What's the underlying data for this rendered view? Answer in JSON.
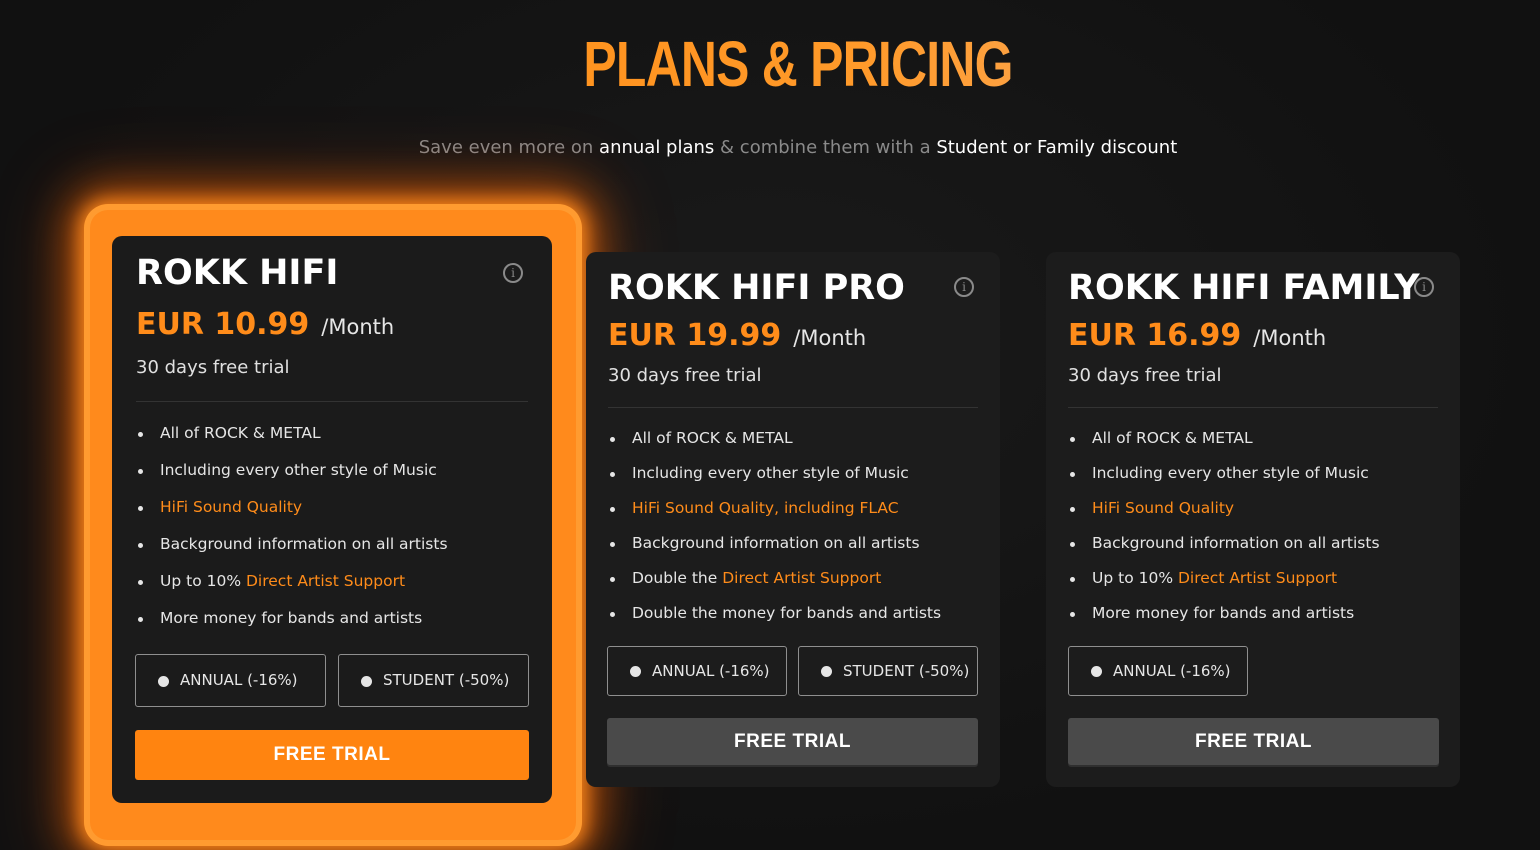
{
  "header": {
    "title": "PLANS & PRICING",
    "subtitle_parts": [
      "Save even more on ",
      "annual plans",
      " & combine them with a ",
      "Student or Family discount"
    ]
  },
  "colors": {
    "accent": "#ff8c1a",
    "background": "#111111",
    "card": "#1c1c1c",
    "cta_primary": "#ff8410",
    "cta_secondary": "#4a4a4a"
  },
  "plans": [
    {
      "name": "ROKK HIFI",
      "price": "EUR 10.99",
      "period": "/Month",
      "trial_note": "30 days free trial",
      "info_icon": "info-circle-icon",
      "highlighted": true,
      "features": [
        {
          "text": "All of ROCK & METAL",
          "prefix": "",
          "accent": ""
        },
        {
          "text": "Including every other style of Music",
          "prefix": "",
          "accent": ""
        },
        {
          "text": "",
          "prefix": "",
          "accent": "HiFi Sound Quality"
        },
        {
          "text": "Background information on all artists",
          "prefix": "",
          "accent": ""
        },
        {
          "text": "",
          "prefix": "Up to 10% ",
          "accent": "Direct Artist Support"
        },
        {
          "text": "More money for bands and artists",
          "prefix": "",
          "accent": ""
        }
      ],
      "options": [
        "ANNUAL (-16%)",
        "STUDENT (-50%)"
      ],
      "cta": "FREE TRIAL"
    },
    {
      "name": "ROKK HIFI PRO",
      "price": "EUR 19.99",
      "period": "/Month",
      "trial_note": "30 days free trial",
      "info_icon": "info-circle-icon",
      "highlighted": false,
      "features": [
        {
          "text": "All of ROCK & METAL",
          "prefix": "",
          "accent": ""
        },
        {
          "text": "Including every other style of Music",
          "prefix": "",
          "accent": ""
        },
        {
          "text": "",
          "prefix": "",
          "accent": "HiFi Sound Quality, including FLAC"
        },
        {
          "text": "Background information on all artists",
          "prefix": "",
          "accent": ""
        },
        {
          "text": "",
          "prefix": "Double the ",
          "accent": "Direct Artist Support"
        },
        {
          "text": "Double the money for bands and artists",
          "prefix": "",
          "accent": ""
        }
      ],
      "options": [
        "ANNUAL (-16%)",
        "STUDENT (-50%)"
      ],
      "cta": "FREE TRIAL"
    },
    {
      "name": "ROKK HIFI FAMILY",
      "price": "EUR 16.99",
      "period": "/Month",
      "trial_note": "30 days free trial",
      "info_icon": "info-circle-icon",
      "highlighted": false,
      "features": [
        {
          "text": "All of ROCK & METAL",
          "prefix": "",
          "accent": ""
        },
        {
          "text": "Including every other style of Music",
          "prefix": "",
          "accent": ""
        },
        {
          "text": "",
          "prefix": "",
          "accent": "HiFi Sound Quality"
        },
        {
          "text": "Background information on all artists",
          "prefix": "",
          "accent": ""
        },
        {
          "text": "",
          "prefix": "Up to 10% ",
          "accent": "Direct Artist Support"
        },
        {
          "text": "More money for bands and artists",
          "prefix": "",
          "accent": ""
        }
      ],
      "options": [
        "ANNUAL (-16%)"
      ],
      "cta": "FREE TRIAL"
    }
  ]
}
